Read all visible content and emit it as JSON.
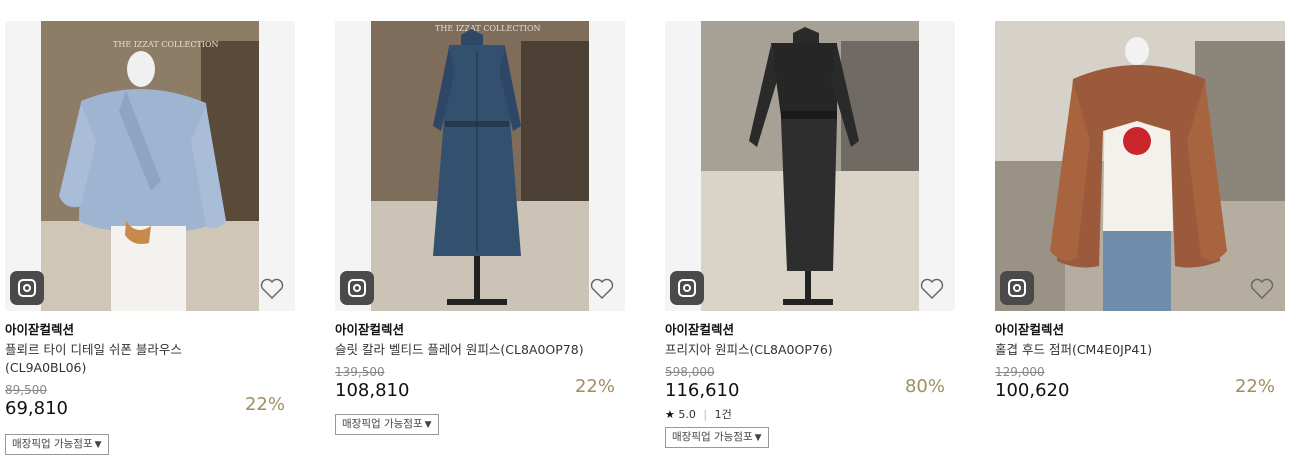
{
  "products": [
    {
      "brand": "아이잗컬렉션",
      "name": "플뢰르 타이 디테일 쉬폰 블라우스(CL9A0BL06)",
      "original_price": "89,500",
      "price": "69,810",
      "discount": "22%",
      "pickup_label": "매장픽업 가능점포",
      "image_sign": "THE IZZAT COLLECTION"
    },
    {
      "brand": "아이잗컬렉션",
      "name": "슬릿 칼라 벨티드 플레어 원피스(CL8A0OP78)",
      "original_price": "139,500",
      "price": "108,810",
      "discount": "22%",
      "pickup_label": "매장픽업 가능점포",
      "image_sign": "THE IZZAT COLLECTION"
    },
    {
      "brand": "아이잗컬렉션",
      "name": "프리지아 원피스(CL8A0OP76)",
      "original_price": "598,000",
      "price": "116,610",
      "discount": "80%",
      "rating": "5.0",
      "review_count": "1건",
      "pickup_label": "매장픽업 가능점포"
    },
    {
      "brand": "아이잗컬렉션",
      "name": "홀겹 후드 점퍼(CM4E0JP41)",
      "original_price": "129,000",
      "price": "100,620",
      "discount": "22%"
    }
  ],
  "colors": {
    "discount": "#9e8e62",
    "insta_badge": "#4a4a4a"
  },
  "icons": [
    "instagram-icon",
    "heart-outline-icon",
    "star-icon",
    "caret-down-icon"
  ]
}
